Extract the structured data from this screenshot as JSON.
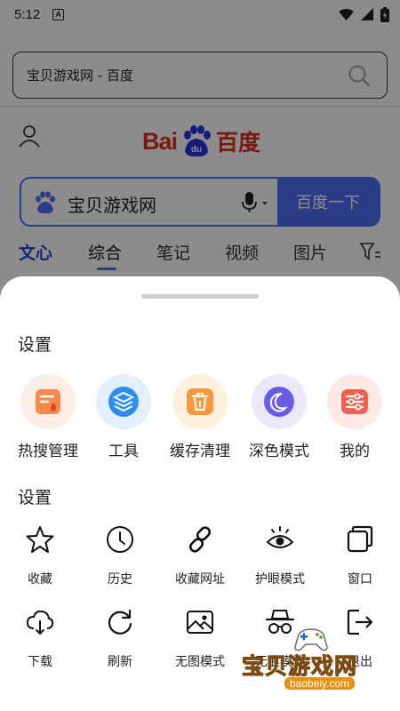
{
  "status_bar": {
    "time": "5:12",
    "notification_badge": "A"
  },
  "url_bar": {
    "text": "宝贝游戏网 - 百度"
  },
  "baidu": {
    "logo_latin": "Bai",
    "logo_du": "du",
    "logo_cn": "百度"
  },
  "search": {
    "query": "宝贝游戏网",
    "button": "百度一下"
  },
  "tabs": [
    "文心",
    "综合",
    "笔记",
    "视频",
    "图片"
  ],
  "sheet": {
    "section1_title": "设置",
    "featured": [
      {
        "label": "热搜管理",
        "icon": "hot-search-icon",
        "bg": "#fdeee5",
        "fg": "#f6894a"
      },
      {
        "label": "工具",
        "icon": "tools-icon",
        "bg": "#e4effd",
        "fg": "#2f8cf0"
      },
      {
        "label": "缓存清理",
        "icon": "trash-icon",
        "bg": "#fff1de",
        "fg": "#f7993a"
      },
      {
        "label": "深色模式",
        "icon": "moon-icon",
        "bg": "#ebe8fb",
        "fg": "#6b5ce8"
      },
      {
        "label": "我的",
        "icon": "sliders-icon",
        "bg": "#fde9e6",
        "fg": "#f0614f"
      }
    ],
    "section2_title": "设置",
    "grid": [
      {
        "label": "收藏",
        "icon": "star-icon"
      },
      {
        "label": "历史",
        "icon": "clock-icon"
      },
      {
        "label": "收藏网址",
        "icon": "link-icon"
      },
      {
        "label": "护眼模式",
        "icon": "eye-icon"
      },
      {
        "label": "窗口",
        "icon": "windows-icon"
      },
      {
        "label": "下载",
        "icon": "cloud-download-icon"
      },
      {
        "label": "刷新",
        "icon": "refresh-icon"
      },
      {
        "label": "无图模式",
        "icon": "image-icon"
      },
      {
        "label": "无痕模式",
        "icon": "incognito-icon"
      },
      {
        "label": "退出",
        "icon": "exit-icon"
      }
    ]
  },
  "watermark": {
    "text": "宝贝游戏网",
    "url": "baobeiy.com"
  }
}
